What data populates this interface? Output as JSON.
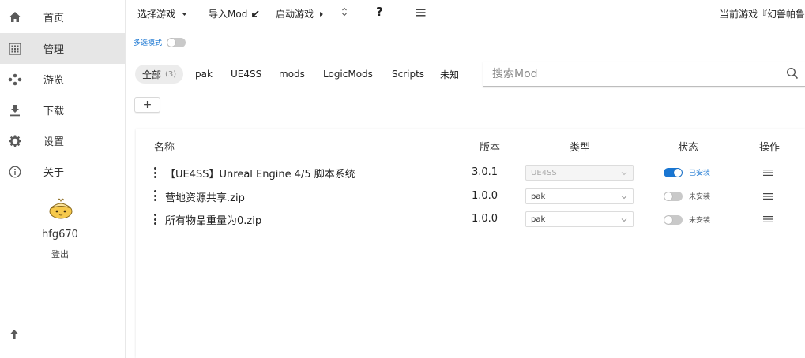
{
  "sidebar": {
    "items": [
      {
        "label": "首页",
        "icon": "home-icon"
      },
      {
        "label": "管理",
        "icon": "grid-icon",
        "active": true
      },
      {
        "label": "游览",
        "icon": "explore-icon"
      },
      {
        "label": "下载",
        "icon": "download-icon"
      },
      {
        "label": "设置",
        "icon": "gear-icon"
      },
      {
        "label": "关于",
        "icon": "info-icon"
      }
    ],
    "user": {
      "name": "hfg670",
      "logout": "登出"
    }
  },
  "toolbar": {
    "select_game": "选择游戏",
    "import_mod": "导入Mod",
    "launch_game": "启动游戏",
    "help": "?",
    "current_game": "当前游戏『幻兽帕鲁"
  },
  "multi_select": {
    "label": "多选模式",
    "enabled": false
  },
  "tabs": [
    {
      "label": "全部",
      "count": "(3)",
      "active": true
    },
    {
      "label": "pak"
    },
    {
      "label": "UE4SS"
    },
    {
      "label": "mods"
    },
    {
      "label": "LogicMods"
    },
    {
      "label": "Scripts"
    },
    {
      "label": "未知"
    }
  ],
  "search": {
    "placeholder": "搜索Mod",
    "value": ""
  },
  "add_button": "+",
  "table": {
    "headers": {
      "name": "名称",
      "version": "版本",
      "type": "类型",
      "status": "状态",
      "actions": "操作"
    },
    "rows": [
      {
        "name": "【UE4SS】Unreal Engine 4/5 脚本系统",
        "version": "3.0.1",
        "type": "UE4SS",
        "type_disabled": true,
        "installed": true,
        "status": "已安装"
      },
      {
        "name": "营地资源共享.zip",
        "version": "1.0.0",
        "type": "pak",
        "type_disabled": false,
        "installed": false,
        "status": "未安装"
      },
      {
        "name": "所有物品重量为0.zip",
        "version": "1.0.0",
        "type": "pak",
        "type_disabled": false,
        "installed": false,
        "status": "未安装"
      }
    ]
  },
  "colors": {
    "accent": "#1976d2",
    "active_nav": "#e6e6e6",
    "switch_off": "#c9c9c9"
  }
}
